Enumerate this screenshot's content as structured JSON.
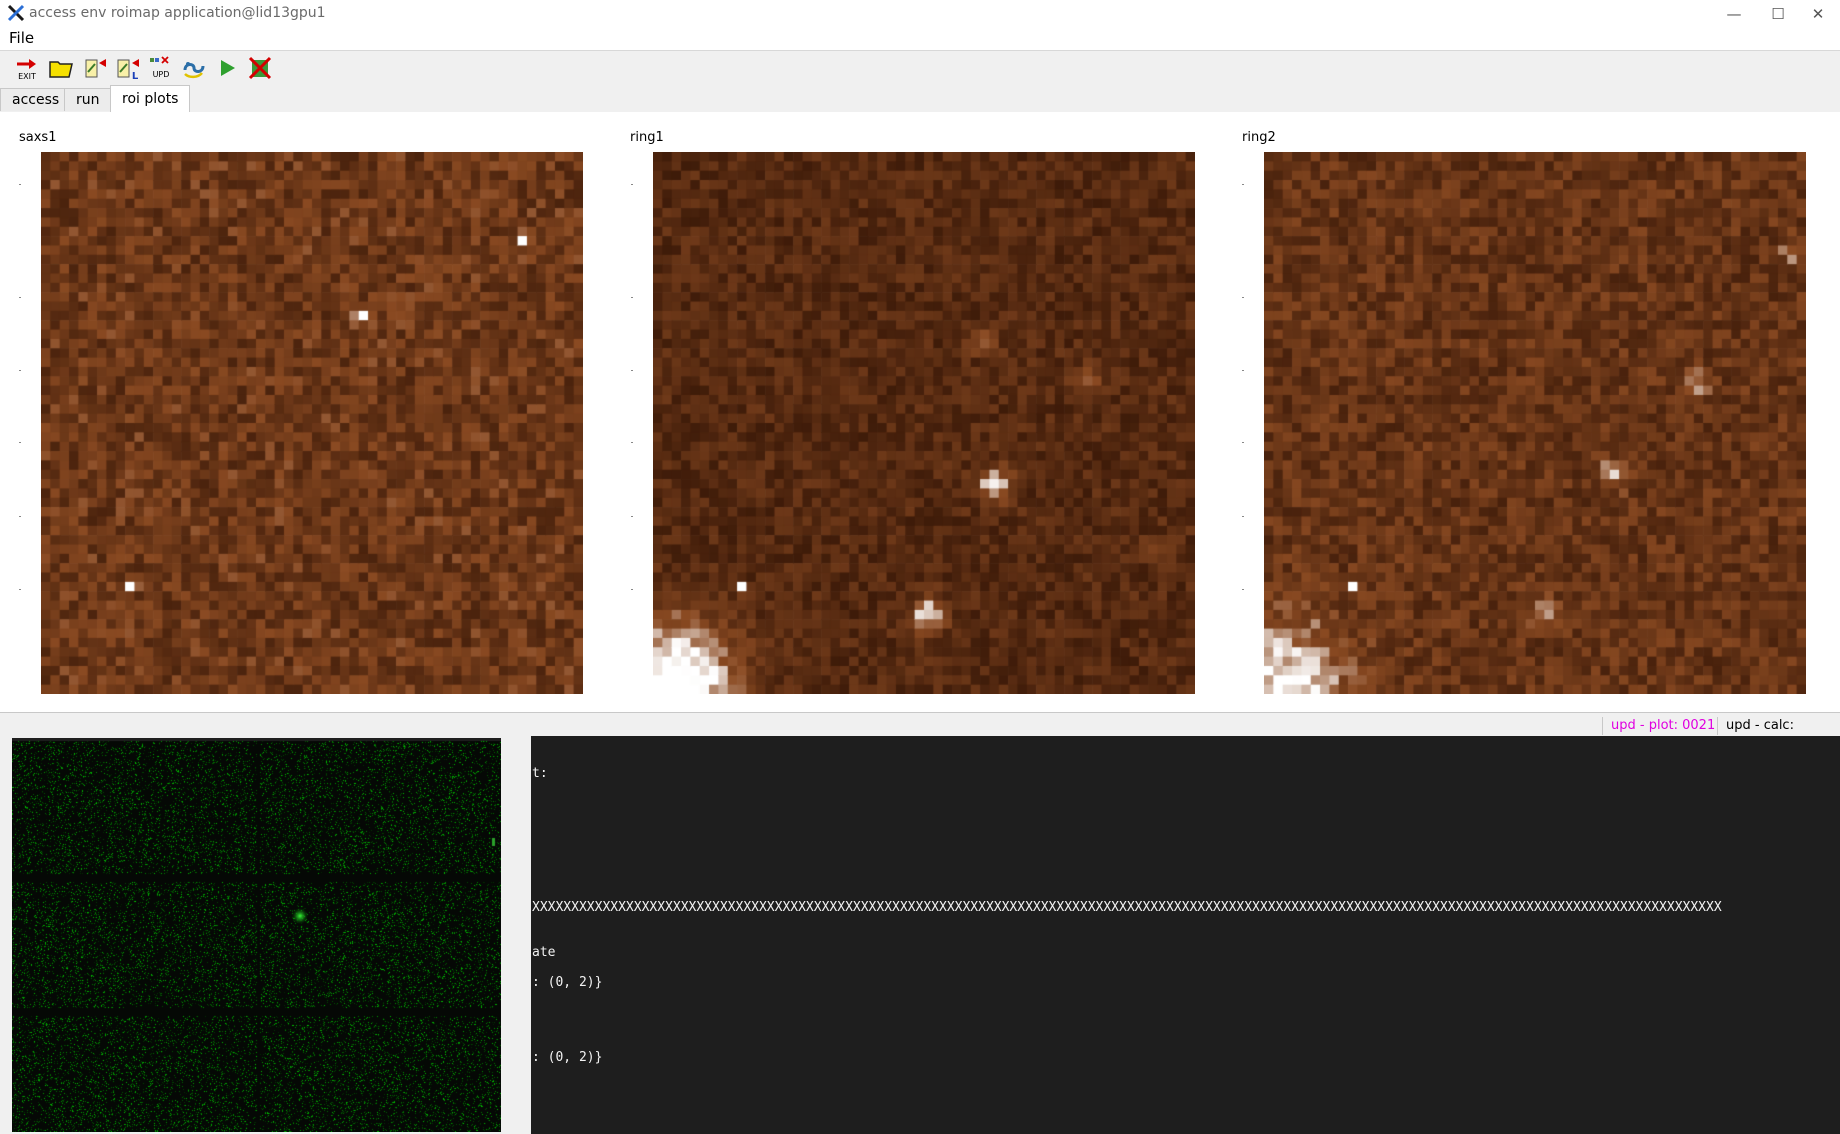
{
  "window": {
    "title": "access env roimap application@lid13gpu1",
    "minimize_glyph": "—",
    "maximize_glyph": "☐",
    "close_glyph": "✕"
  },
  "menu": {
    "file_label": "File"
  },
  "toolbar": {
    "exit_label": "EXIT",
    "upd_label": "UPD",
    "load_label": "L",
    "tools": [
      "exit-icon",
      "open-folder-icon",
      "page-arrow-icon",
      "page-load-icon",
      "update-icon",
      "python-icon",
      "play-icon",
      "stop-icon"
    ]
  },
  "tabs": [
    {
      "label": "access",
      "active": false
    },
    {
      "label": "run",
      "active": false
    },
    {
      "label": "roi plots",
      "active": true
    }
  ],
  "plots": [
    {
      "title": "saxs1"
    },
    {
      "title": "ring1"
    },
    {
      "title": "ring2"
    }
  ],
  "status": {
    "plot_update": "upd - plot: 0021",
    "calc_update": "upd - calc:",
    "plot_update_color": "#e000e0"
  },
  "terminal": {
    "lines": [
      "t:",
      "XXXXXXXXXXXXXXXXXXXXXXXXXXXXXXXXXXXXXXXXXXXXXXXXXXXXXXXXXXXXXXXXXXXXXXXXXXXXXXXXXXXXXXXXXXXXXXXXXXXXXXXXXXXXXXXXXXXXXXXXXXXXXXXXXXXXXXXXXXXXXXXXXXXXXXXX",
      "ate",
      ": (0, 2)}",
      ": (0, 2)}"
    ]
  },
  "colors": {
    "heatmap_dark": "#2a0f03",
    "heatmap_mid": "#8a4a22",
    "heatmap_light": "#ffffff",
    "detector_green": "#00c800",
    "terminal_bg": "#1e1e1e"
  }
}
